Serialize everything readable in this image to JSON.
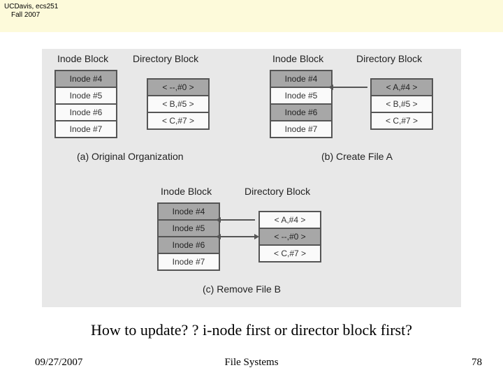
{
  "header": {
    "line1": "UCDavis, ecs251",
    "line2": "Fall 2007"
  },
  "diagram": {
    "columns": {
      "inode": "Inode Block",
      "directory": "Directory Block"
    },
    "inode_rows": [
      "Inode #4",
      "Inode #5",
      "Inode #6",
      "Inode #7"
    ],
    "panel_a": {
      "caption": "(a) Original Organization",
      "dir_rows": [
        "< --,#0 >",
        "< B,#5 >",
        "< C,#7 >"
      ]
    },
    "panel_b": {
      "caption": "(b) Create File A",
      "dir_rows": [
        "< A,#4 >",
        "< B,#5 >",
        "< C,#7 >"
      ]
    },
    "panel_c": {
      "caption": "(c) Remove File B",
      "dir_rows": [
        "< A,#4 >",
        "< --,#0 >",
        "< C,#7 >"
      ]
    }
  },
  "question": "How to update? ? i-node first or director block first?",
  "footer": {
    "date": "09/27/2007",
    "title": "File Systems",
    "page": "78"
  }
}
